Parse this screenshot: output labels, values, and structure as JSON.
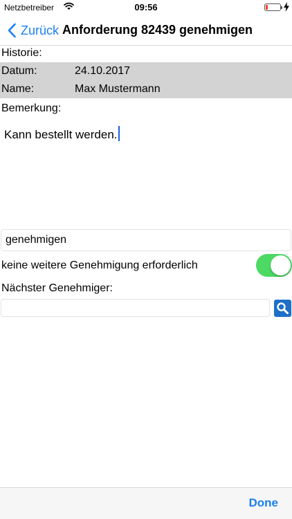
{
  "status_bar": {
    "carrier": "Netzbetreiber",
    "time": "09:56",
    "battery_level": 0.15,
    "battery_color": "#ff3b30",
    "icons": [
      "wifi-icon",
      "battery-icon",
      "charging-icon"
    ]
  },
  "nav": {
    "back_label": "Zurück",
    "title": "Anforderung 82439 genehmigen",
    "accent_color": "#1a7ff0"
  },
  "history": {
    "label": "Historie:",
    "date_label": "Datum:",
    "date_value": "24.10.2017",
    "name_label": "Name:",
    "name_value": "Max Mustermann"
  },
  "remark": {
    "label": "Bemerkung:",
    "text": "Kann bestellt werden."
  },
  "decision": {
    "selected": "genehmigen"
  },
  "no_further_approval": {
    "label": "keine weitere Genehmigung erforderlich",
    "enabled": true,
    "on_color": "#4cd964"
  },
  "next_approver": {
    "label": "Nächster Genehmiger:",
    "value": "",
    "search_icon": "magnifier-icon"
  },
  "toolbar": {
    "done_label": "Done"
  }
}
